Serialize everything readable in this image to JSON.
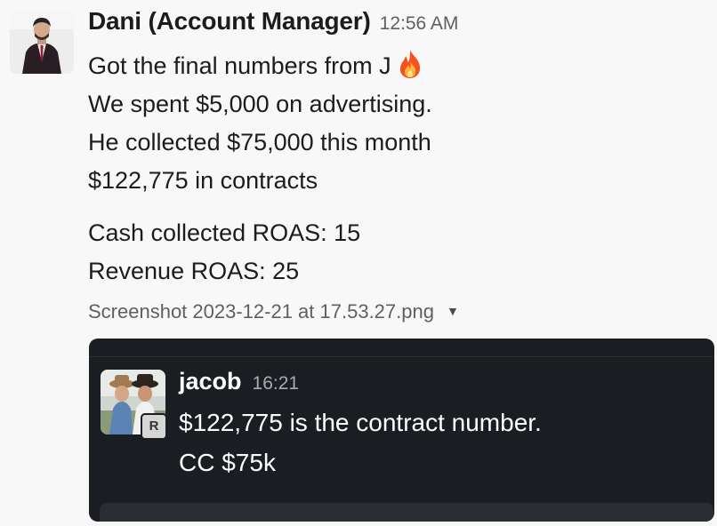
{
  "message": {
    "sender": "Dani (Account Manager)",
    "time": "12:56 AM",
    "lines": [
      "Got the final numbers from J",
      "We spent $5,000 on advertising.",
      "He collected $75,000 this month",
      "$122,775 in contracts"
    ],
    "lines2": [
      "Cash collected ROAS: 15",
      "Revenue ROAS: 25"
    ],
    "emoji": "fire-icon"
  },
  "attachment": {
    "filename": "Screenshot 2023-12-21 at 17.53.27.png",
    "toggle_icon": "caret-down-icon"
  },
  "preview": {
    "sender": "jacob",
    "time": "16:21",
    "badge": "R",
    "lines": [
      "$122,775 is the contract number.",
      "CC $75k"
    ]
  },
  "colors": {
    "background": "#f8f8f8",
    "text": "#1d1c1d",
    "muted": "#616061",
    "preview_background": "#1a1d21"
  }
}
